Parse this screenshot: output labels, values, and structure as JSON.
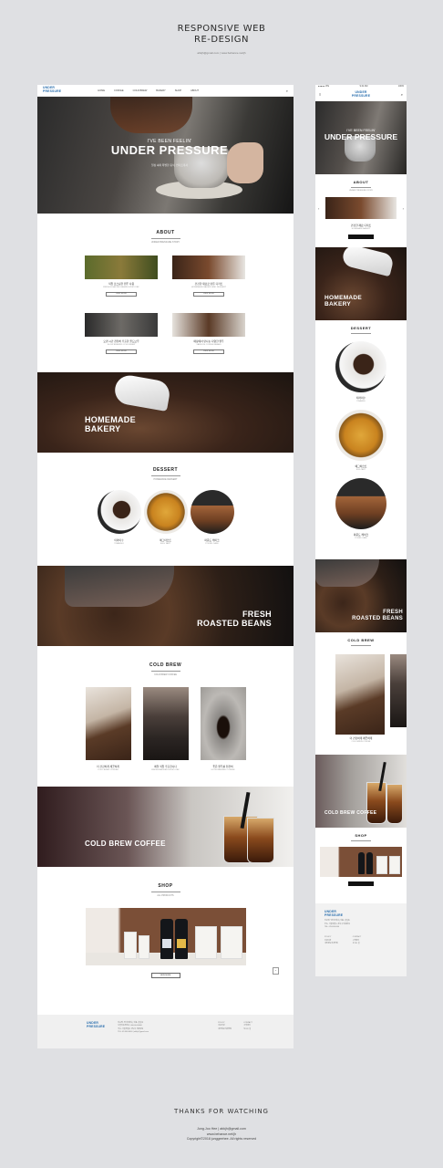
{
  "header": {
    "title_line1": "RESPONSIVE WEB",
    "title_line2": "RE-DESIGN",
    "subtitle": "abkjh@gmail.com | www.behance.net/jh"
  },
  "desktop": {
    "logo": "UNDER\nPRESSURE",
    "nav": [
      "HOME",
      "COFFEE",
      "COLD BREW",
      "BAKERY",
      "SHOP",
      "ABOUT"
    ],
    "hero": {
      "tagline": "I'VE BEEN FEELIN'",
      "title": "UNDER PRESSURE",
      "desc": "일상 속의 특별한 휴식, 언더프레셔"
    },
    "about": {
      "title": "ABOUT",
      "sub": "UNDER PRESSURE STORY",
      "cards": [
        {
          "cap": "직접 로스팅한 원두 사용",
          "cap2": "FRESH ROASTED BEANS EVERY DAY",
          "btn": "VIEW MORE"
        },
        {
          "cap": "건강한 재료로 만든 디저트",
          "cap2": "HOMEMADE BAKERY AND DESSERT",
          "btn": "VIEW MORE"
        },
        {
          "cap": "오랜 시간 천천히 추출한 콜드브루",
          "cap2": "SLOW BREWED COLD BREW",
          "btn": "VIEW MORE"
        },
        {
          "cap": "매장에서 만나는 다양한 원두",
          "cap2": "VARIOUS COFFEE BEANS",
          "btn": "VIEW MORE"
        }
      ]
    },
    "bakery": {
      "line1": "HOMEMADE",
      "line2": "BAKERY"
    },
    "dessert": {
      "title": "DESSERT",
      "sub": "HOMEMADE DESSERT",
      "items": [
        {
          "cap": "티라미수",
          "cap2": "TIRAMISU"
        },
        {
          "cap": "에그타르트",
          "cap2": "EGG TART"
        },
        {
          "cap": "파운드 케이크",
          "cap2": "POUND CAKE"
        }
      ]
    },
    "beans": {
      "line1": "FRESH",
      "line2": "ROASTED BEANS"
    },
    "coldbrew": {
      "title": "COLD BREW",
      "sub": "COLD BREW COFFEE",
      "items": [
        {
          "cap": "더 건강하게 깨끗하게",
          "cap2": "COLD BREW COFFEE"
        },
        {
          "cap": "매일 직접 추출합니다",
          "cap2": "FRESH BREWED EVERY DAY"
        },
        {
          "cap": "좋은 원두를 천천히",
          "cap2": "SLOW BREWED COFFEE"
        }
      ]
    },
    "cbc": {
      "label": "COLD BREW COFFEE"
    },
    "shop": {
      "title": "SHOP",
      "sub": "ALL PRODUCTS",
      "btn": "VIEW MORE",
      "top": "^"
    },
    "footer": {
      "logo": "UNDER\nPRESSURE",
      "info": [
        "상호명: 언더프레셔 | 대표: 홍길동",
        "사업자등록번호: 000-00-00000",
        "주소: 서울특별시 강남구 테헤란로",
        "TEL: 02-000-0000 | abkjh@gmail.com"
      ],
      "col1": [
        "POLICY",
        "이용약관",
        "개인정보처리방침"
      ],
      "col2": [
        "CONTACT",
        "고객센터",
        "오시는 길"
      ]
    }
  },
  "mobile": {
    "status": {
      "carrier": "●●●●● LTE",
      "time": "9:41 AM",
      "battery": "100%"
    },
    "logo": "UNDER\nPRESSURE",
    "hero": {
      "tagline": "I'VE BEEN FEELIN'",
      "title": "UNDER PRESSURE"
    },
    "about": {
      "title": "ABOUT",
      "sub": "UNDER PRESSURE STORY",
      "cap": "건강한 재료 디저트",
      "cap2": "HOMEMADE BAKERY"
    },
    "bakery": {
      "line1": "HOMEMADE",
      "line2": "BAKERY"
    },
    "dessert": {
      "title": "DESSERT",
      "items": [
        {
          "cap": "티라미수",
          "cap2": "TIRAMISU"
        },
        {
          "cap": "에그타르트",
          "cap2": "EGG TART"
        },
        {
          "cap": "파운드 케이크",
          "cap2": "POUND CAKE"
        }
      ]
    },
    "beans": {
      "line1": "FRESH",
      "line2": "ROASTED BEANS"
    },
    "coldbrew": {
      "title": "COLD BREW",
      "cap": "더 건강하게 깨끗하게",
      "cap2": "COLD BREW COFFEE"
    },
    "cbc": {
      "label": "COLD BREW COFFEE"
    },
    "shop": {
      "title": "SHOP"
    },
    "footer": {
      "logo": "UNDER\nPRESSURE",
      "info": [
        "상호명: 언더프레셔 | 대표: 홍길동",
        "주소: 서울특별시 강남구 테헤란로",
        "TEL: 02-000-0000"
      ],
      "col1": [
        "POLICY",
        "이용약관",
        "개인정보처리방침"
      ],
      "col2": [
        "CONTACT",
        "고객센터",
        "오시는 길"
      ]
    }
  },
  "closing": {
    "thanks": "THANKS FOR WATCHING",
    "credit1": "Jung.Joo Hee | abkjh@gmail.com",
    "credit2": "www.behance.net/jh",
    "credit3": "Copyright©2018 junggeehee. All rights reserved"
  }
}
